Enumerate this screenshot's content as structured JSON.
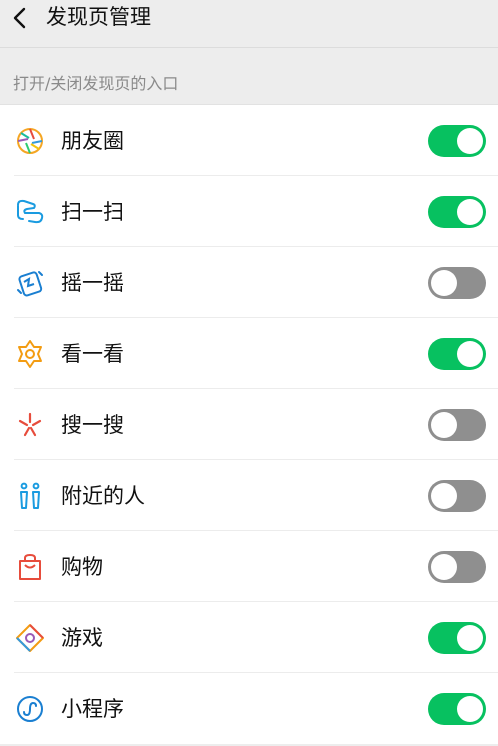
{
  "header": {
    "title": "发现页管理"
  },
  "section_label": "打开/关闭发现页的入口",
  "items": [
    {
      "label": "朋友圈",
      "icon": "moments-icon",
      "enabled": true
    },
    {
      "label": "扫一扫",
      "icon": "scan-icon",
      "enabled": true
    },
    {
      "label": "摇一摇",
      "icon": "shake-icon",
      "enabled": false
    },
    {
      "label": "看一看",
      "icon": "top-stories-icon",
      "enabled": true
    },
    {
      "label": "搜一搜",
      "icon": "search-icon",
      "enabled": false
    },
    {
      "label": "附近的人",
      "icon": "people-nearby-icon",
      "enabled": false
    },
    {
      "label": "购物",
      "icon": "shopping-bag-icon",
      "enabled": false
    },
    {
      "label": "游戏",
      "icon": "games-icon",
      "enabled": true
    },
    {
      "label": "小程序",
      "icon": "mini-programs-icon",
      "enabled": true
    }
  ],
  "colors": {
    "toggle_on": "#07c160",
    "toggle_off": "#8f8f8f"
  }
}
